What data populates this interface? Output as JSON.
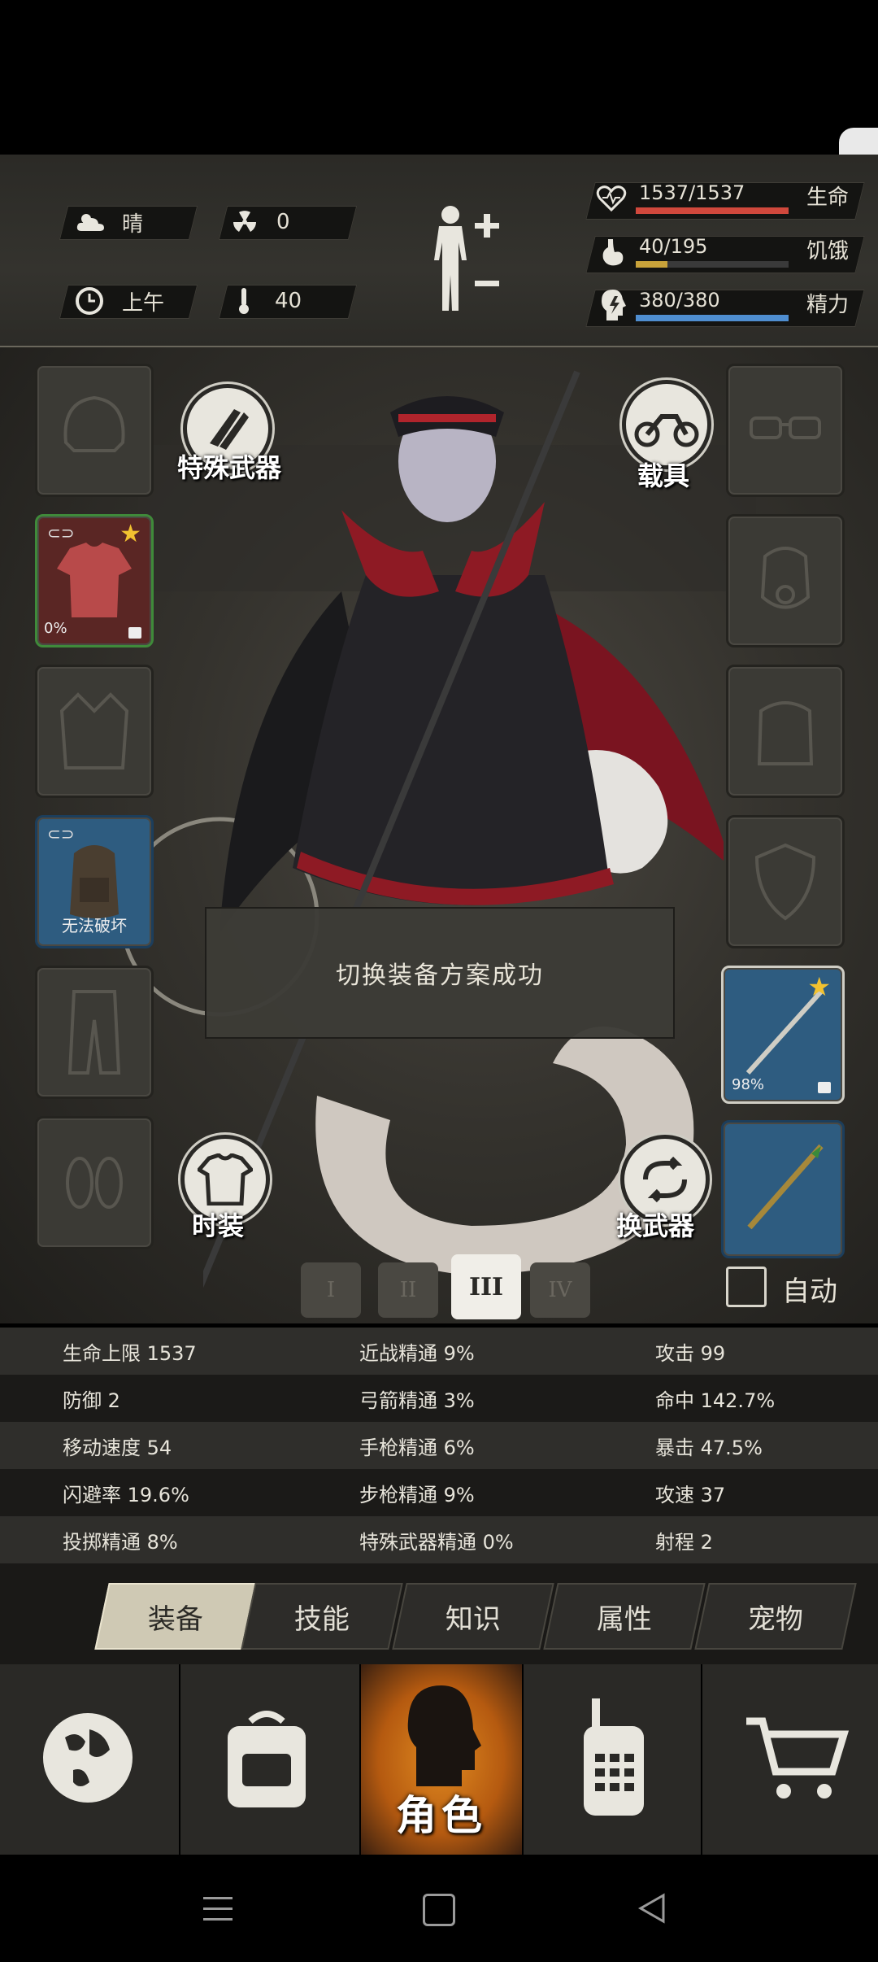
{
  "status": {
    "weather": "晴",
    "radiation": "0",
    "time_of_day": "上午",
    "temperature": "40",
    "health_text": "1537/1537",
    "health_label": "生命",
    "health_fraction": 1.0,
    "hunger_text": "40/195",
    "hunger_label": "饥饿",
    "hunger_fraction": 0.205,
    "energy_text": "380/380",
    "energy_label": "精力",
    "energy_fraction": 1.0
  },
  "equipment": {
    "special_weapon_label": "特殊武器",
    "vehicle_label": "载具",
    "fashion_label": "时装",
    "switch_weapon_label": "换武器",
    "shirt_durability": "0%",
    "backpack_tag": "无法破坏",
    "spear_durability": "98%",
    "loadouts": [
      "I",
      "II",
      "III",
      "IV"
    ],
    "active_loadout": "III",
    "auto_label": "自动"
  },
  "toast": "切换装备方案成功",
  "stats": [
    [
      "生命上限 1537",
      "近战精通 9%",
      "攻击 99"
    ],
    [
      "防御 2",
      "弓箭精通 3%",
      "命中 142.7%"
    ],
    [
      "移动速度 54",
      "手枪精通 6%",
      "暴击 47.5%"
    ],
    [
      "闪避率 19.6%",
      "步枪精通 9%",
      "攻速 37"
    ],
    [
      "投掷精通 8%",
      "特殊武器精通 0%",
      "射程 2"
    ]
  ],
  "tabs": [
    "装备",
    "技能",
    "知识",
    "属性",
    "宠物"
  ],
  "active_tab": "装备",
  "bottom_nav": {
    "character_label": "角色"
  },
  "colors": {
    "health": "#d0483c",
    "hunger": "#c9a33a",
    "energy": "#4f8ed0",
    "active_nav": "#e07a1a",
    "gold_slot_border": "#3f8a3a",
    "blue_slot": "#2e5c80"
  }
}
